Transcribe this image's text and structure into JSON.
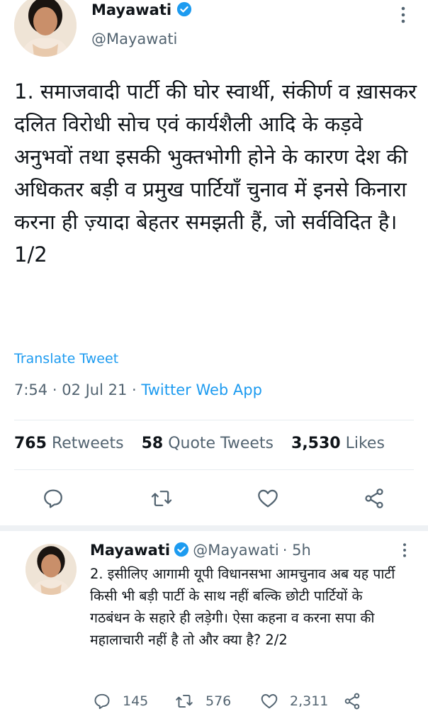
{
  "tweet": {
    "author_name": "Mayawati",
    "author_handle": "@Mayawati",
    "text": "1. समाजवादी पार्टी की घोर स्वार्थी, संकीर्ण व ख़ासकर दलित विरोधी सोच एवं कार्यशैली आदि के कड़वे अनुभवों तथा इसकी भुक्तभोगी होने के कारण देश की अधिकतर बड़ी व प्रमुख पार्टियाँ चुनाव में इनसे किनारा करना ही ज़्यादा बेहतर समझती हैं, जो सर्वविदित है। 1/2",
    "translate_label": "Translate Tweet",
    "time": "7:54",
    "date": "02 Jul 21",
    "source": "Twitter Web App",
    "retweets_count": "765",
    "retweets_label": "Retweets",
    "quote_count": "58",
    "quote_label": "Quote Tweets",
    "likes_count": "3,530",
    "likes_label": "Likes"
  },
  "reply": {
    "author_name": "Mayawati",
    "author_handle": "@Mayawati",
    "age": "5h",
    "text": "2. इसीलिए आगामी यूपी विधानसभा आमचुनाव अब यह पार्टी किसी भी बड़ी पार्टी के साथ नहीं बल्कि छोटी पार्टियों के गठबंधन के सहारे ही लड़ेगी। ऐसा कहना व करना सपा की महालाचारी नहीं है तो और क्या है? 2/2",
    "reply_count": "145",
    "retweet_count": "576",
    "like_count": "2,311"
  },
  "icons": {
    "verified": "verified-badge-icon",
    "more": "more-options-icon",
    "reply": "reply-icon",
    "retweet": "retweet-icon",
    "like": "heart-icon",
    "share": "share-icon"
  },
  "colors": {
    "accent": "#1d9bf0",
    "text": "#0f1419",
    "secondary": "#536471",
    "divider": "#e6ecf0"
  }
}
